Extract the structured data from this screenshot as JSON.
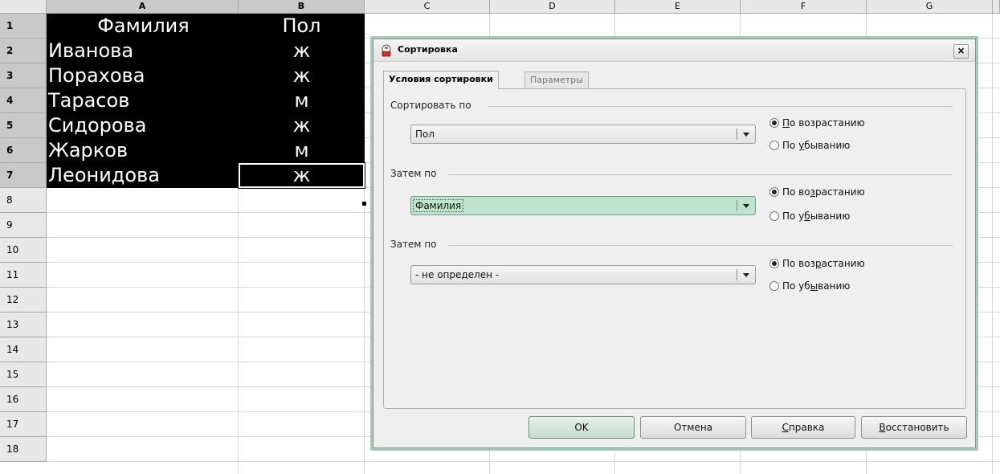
{
  "spreadsheet": {
    "columns": [
      "A",
      "B",
      "C",
      "D",
      "E",
      "F",
      "G"
    ],
    "rows": [
      "1",
      "2",
      "3",
      "4",
      "5",
      "6",
      "7",
      "8",
      "9",
      "10",
      "11",
      "12",
      "13",
      "14",
      "15",
      "16",
      "17",
      "18"
    ],
    "cells": [
      {
        "a": "Фамилия",
        "b": "Пол"
      },
      {
        "a": "Иванова",
        "b": "ж"
      },
      {
        "a": "Порахова",
        "b": "ж"
      },
      {
        "a": "Тарасов",
        "b": "м"
      },
      {
        "a": "Сидорова",
        "b": "ж"
      },
      {
        "a": "Жарков",
        "b": "м"
      },
      {
        "a": "Леонидова",
        "b": "ж"
      }
    ]
  },
  "dialog": {
    "title": "Сортировка",
    "close_label": "×",
    "tabs": [
      {
        "label": "Условия сортировки",
        "active": true
      },
      {
        "label": "Параметры",
        "active": false
      }
    ],
    "criteria": [
      {
        "label": "Сортировать по",
        "field": "Пол",
        "ascending": {
          "pre": "",
          "key": "П",
          "post": "о возрастанию"
        },
        "descending": {
          "pre": "По ",
          "key": "у",
          "post": "быванию"
        },
        "selected": "ascending"
      },
      {
        "label": "Затем по",
        "field": "Фамилия",
        "ascending": {
          "pre": "По во",
          "key": "з",
          "post": "растанию"
        },
        "descending": {
          "pre": "По у",
          "key": "б",
          "post": "ыванию"
        },
        "selected": "ascending"
      },
      {
        "label": "Затем по",
        "field": "- не определен -",
        "ascending": {
          "pre": "По воз",
          "key": "р",
          "post": "астанию"
        },
        "descending": {
          "pre": "По уб",
          "key": "ы",
          "post": "ванию"
        },
        "selected": "ascending"
      }
    ],
    "buttons": {
      "ok": "OK",
      "cancel": "Отмена",
      "help": {
        "key": "С",
        "post": "правка"
      },
      "reset": {
        "key": "В",
        "post": "осстановить"
      }
    }
  },
  "colors": {
    "selection_bg": "#000000",
    "selection_text": "#ffffff",
    "focus_highlight": "#bfe4cd"
  }
}
